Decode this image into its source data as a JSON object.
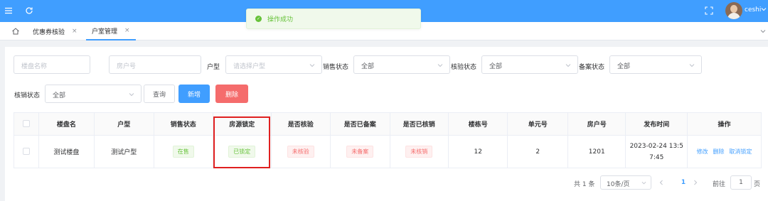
{
  "topbar": {
    "user_name": "ceshi",
    "icons": [
      "menu-icon",
      "refresh-icon",
      "fullscreen-icon",
      "chevron-down-icon"
    ],
    "accent": "#409eff"
  },
  "toast": {
    "message": "操作成功",
    "color": "#67c23a"
  },
  "tabs": [
    {
      "label": "优惠券核验",
      "close": "×",
      "active": false
    },
    {
      "label": "户室管理",
      "close": "×",
      "active": true
    }
  ],
  "filters": {
    "project_name_placeholder": "楼盘名称",
    "room_no_placeholder": "房户号",
    "layout_label": "户型",
    "layout_placeholder": "请选择户型",
    "sales_status_label": "销售状态",
    "sales_status_value": "全部",
    "verify_status_label": "核验状态",
    "verify_status_value": "全部",
    "filing_status_label": "备案状态",
    "filing_status_value": "全部",
    "writeoff_status_label": "核销状态",
    "writeoff_status_value": "全部"
  },
  "buttons": {
    "query": "查询",
    "add": "新增",
    "delete": "删除"
  },
  "table": {
    "headers": [
      "楼盘名",
      "户型",
      "销售状态",
      "房源锁定",
      "是否核验",
      "是否已备案",
      "是否已核销",
      "楼栋号",
      "单元号",
      "房户号",
      "发布时间",
      "操作"
    ],
    "rows": [
      {
        "project": "测试楼盘",
        "layout": "测试户型",
        "sales_status": "在售",
        "locked": "已锁定",
        "verified": "未核验",
        "filed": "未备案",
        "written_off": "未核销",
        "building": "12",
        "unit": "2",
        "room": "1201",
        "publish_time_line1": "2023-02-24 13:5",
        "publish_time_line2": "7:45",
        "actions": [
          "修改",
          "删除",
          "取消锁定"
        ]
      }
    ]
  },
  "pagination": {
    "total": "共 1 条",
    "page_size": "10条/页",
    "current_page": "1",
    "goto_prefix": "前往",
    "goto_value": "1",
    "goto_suffix": "页"
  }
}
